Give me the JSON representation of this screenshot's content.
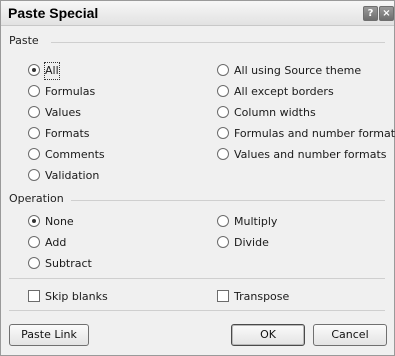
{
  "window": {
    "title": "Paste Special",
    "help_icon": "?",
    "close_icon": "×"
  },
  "paste": {
    "heading": "Paste",
    "left": [
      {
        "label": "All",
        "selected": true
      },
      {
        "label": "Formulas",
        "selected": false
      },
      {
        "label": "Values",
        "selected": false
      },
      {
        "label": "Formats",
        "selected": false
      },
      {
        "label": "Comments",
        "selected": false
      },
      {
        "label": "Validation",
        "selected": false
      }
    ],
    "right": [
      {
        "label": "All using Source theme",
        "selected": false
      },
      {
        "label": "All except borders",
        "selected": false
      },
      {
        "label": "Column widths",
        "selected": false
      },
      {
        "label": "Formulas and number formats",
        "selected": false
      },
      {
        "label": "Values and number formats",
        "selected": false
      }
    ]
  },
  "operation": {
    "heading": "Operation",
    "left": [
      {
        "label": "None",
        "selected": true
      },
      {
        "label": "Add",
        "selected": false
      },
      {
        "label": "Subtract",
        "selected": false
      }
    ],
    "right": [
      {
        "label": "Multiply",
        "selected": false
      },
      {
        "label": "Divide",
        "selected": false
      }
    ]
  },
  "checkboxes": {
    "skip_blanks": {
      "label": "Skip blanks",
      "checked": false
    },
    "transpose": {
      "label": "Transpose",
      "checked": false
    }
  },
  "buttons": {
    "paste_link": "Paste Link",
    "ok": "OK",
    "cancel": "Cancel"
  }
}
